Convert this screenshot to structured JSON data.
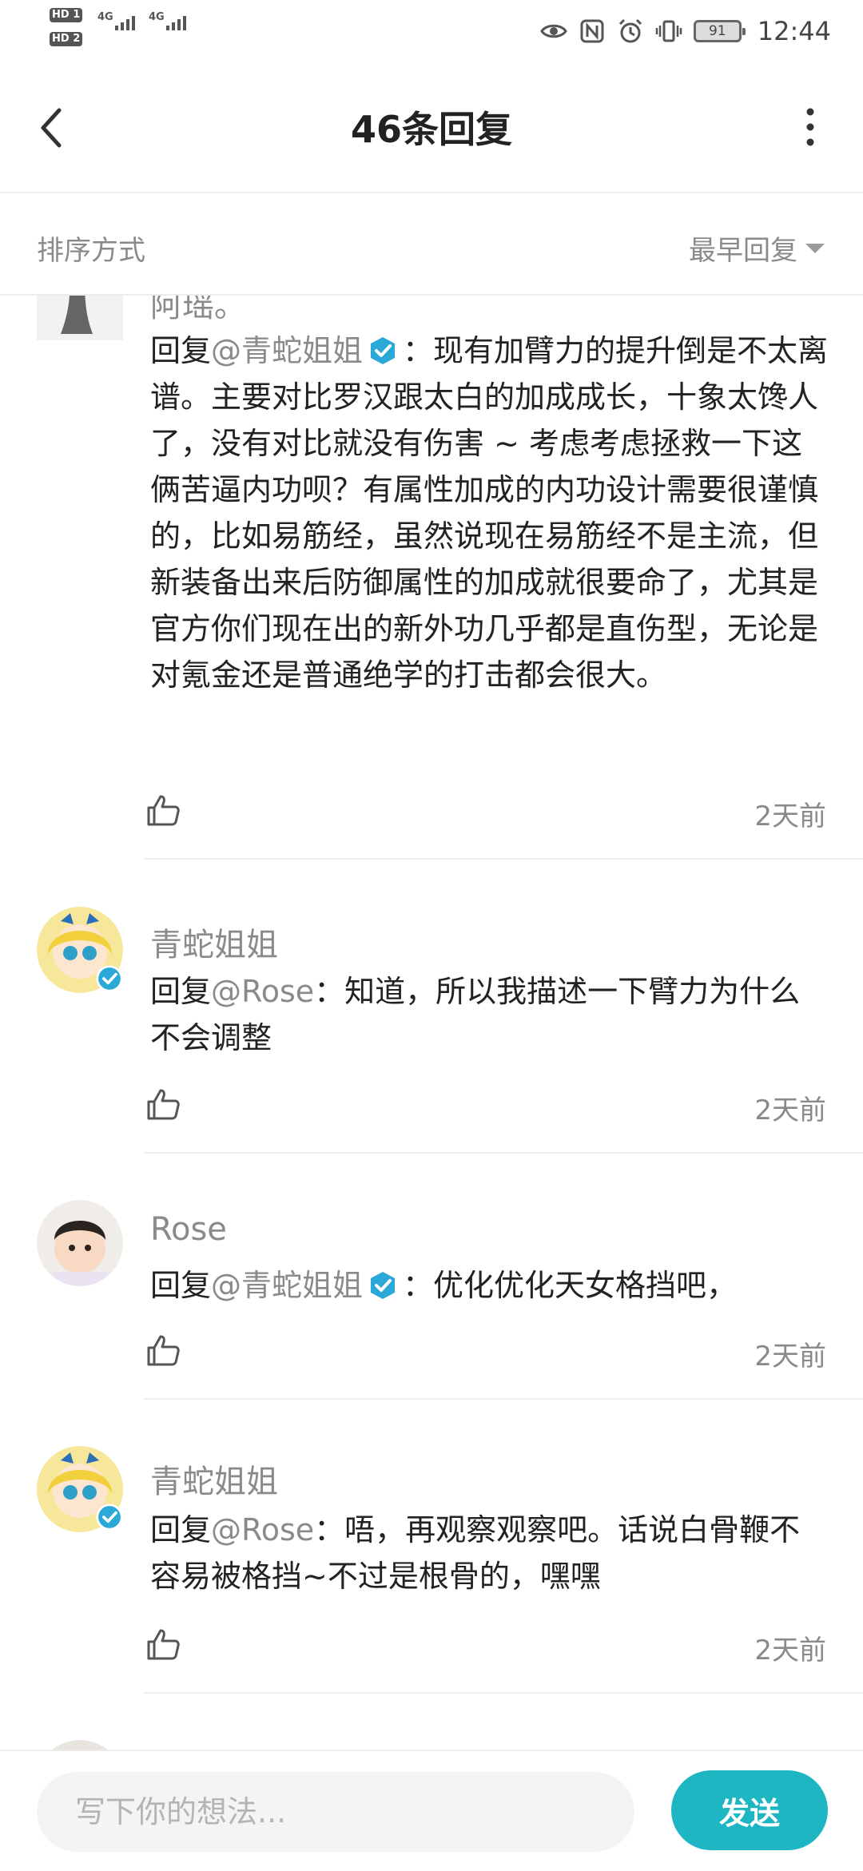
{
  "status_bar": {
    "sim1_badge": "HD 1",
    "sim2_badge": "HD 2",
    "sim1_network": "4G",
    "sim2_network": "4G",
    "battery": "91",
    "time": "12:44",
    "icons": [
      "eye-icon",
      "nfc-icon",
      "alarm-icon",
      "vibrate-icon",
      "battery-icon"
    ]
  },
  "header": {
    "title": "46条回复",
    "back_icon": "chevron-left-icon",
    "more_icon": "more-vertical-icon"
  },
  "sort": {
    "label": "排序方式",
    "selected": "最早回复"
  },
  "comments": [
    {
      "username": "阿瑶。",
      "reply_prefix": "回复",
      "mention": "@青蛇姐姐",
      "mention_verified": true,
      "text": "：现有加臂力的提升倒是不太离谱。主要对比罗汉跟太白的加成成长，十象太馋人了，没有对比就没有伤害 ~ 考虑考虑拯救一下这俩苦逼内功呗？有属性加成的内功设计需要很谨慎的，比如易筋经，虽然说现在易筋经不是主流，但新装备出来后防御属性的加成就很要命了，尤其是官方你们现在出的新外功几乎都是直伤型，无论是对氪金还是普通绝学的打击都会很大。",
      "time": "2天前"
    },
    {
      "username": "青蛇姐姐",
      "verified": true,
      "reply_prefix": "回复",
      "mention": "@Rose",
      "mention_verified": false,
      "text": "：知道，所以我描述一下臂力为什么不会调整",
      "time": "2天前"
    },
    {
      "username": "Rose",
      "reply_prefix": "回复",
      "mention": "@青蛇姐姐",
      "mention_verified": true,
      "text": "：优化优化天女格挡吧，",
      "time": "2天前"
    },
    {
      "username": "青蛇姐姐",
      "verified": true,
      "reply_prefix": "回复",
      "mention": "@Rose",
      "mention_verified": false,
      "text": "：唔，再观察观察吧。话说白骨鞭不容易被格挡~不过是根骨的，嘿嘿",
      "time": "2天前"
    }
  ],
  "composer": {
    "placeholder": "写下你的想法...",
    "send_label": "发送"
  },
  "colors": {
    "accent": "#1fb6c4",
    "muted_text": "#8a8a8a",
    "verified_badge": "#2aa8d8"
  }
}
